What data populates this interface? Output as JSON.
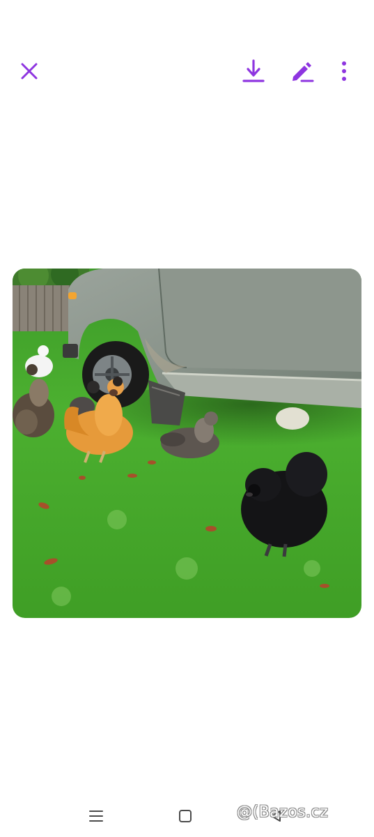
{
  "toolbar": {
    "accent_color": "#8e35e0",
    "close_icon": "close-icon",
    "download_icon": "download-icon",
    "edit_icon": "edit-icon",
    "more_icon": "more-vert-icon"
  },
  "photo": {
    "subject": "chickens-near-car-on-grass"
  },
  "navbar": {
    "menu_icon": "menu-icon",
    "home_icon": "home-icon",
    "back_icon": "back-icon"
  },
  "watermark": {
    "text": "@(Bazos.cz"
  }
}
